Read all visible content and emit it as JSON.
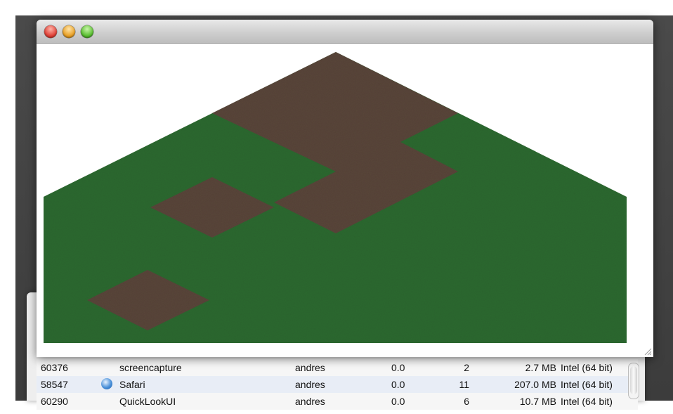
{
  "background_window": {
    "rows": [
      {
        "pid": "60376",
        "icon": "",
        "name": "screencapture",
        "user": "andres",
        "cpu": "0.0",
        "threads": "2",
        "memory": "2.7 MB",
        "kind": "Intel (64 bit)"
      },
      {
        "pid": "58547",
        "icon": "safari-icon",
        "name": "Safari",
        "user": "andres",
        "cpu": "0.0",
        "threads": "11",
        "memory": "207.0 MB",
        "kind": "Intel (64 bit)"
      },
      {
        "pid": "60290",
        "icon": "",
        "name": "QuickLookUI",
        "user": "andres",
        "cpu": "0.0",
        "threads": "6",
        "memory": "10.7 MB",
        "kind": "Intel (64 bit)"
      }
    ]
  },
  "game_window": {
    "title": "",
    "terrain_colors": {
      "grass": "#2d6a30",
      "dirt": "#5a463a",
      "background": "#ffffff"
    }
  }
}
